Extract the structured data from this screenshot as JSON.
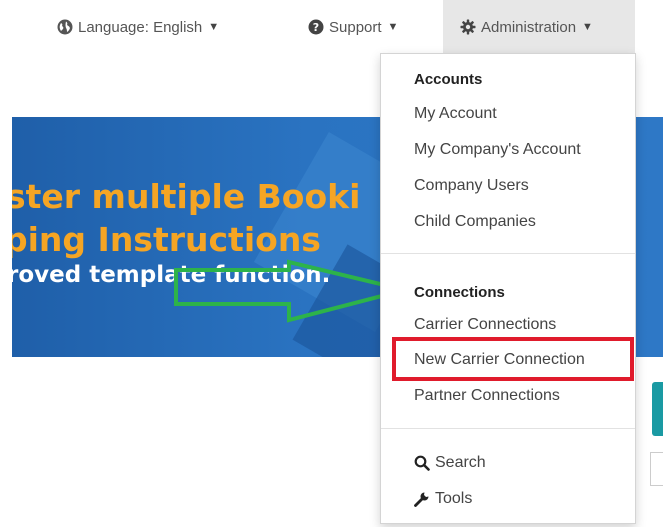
{
  "nav": {
    "language": {
      "label": "Language: English",
      "icon": "globe-icon",
      "caret": "▼"
    },
    "support": {
      "label": "Support",
      "icon": "question-circle-icon",
      "caret": "▼"
    },
    "administration": {
      "label": "Administration",
      "icon": "gear-icon",
      "caret": "▼"
    }
  },
  "banner": {
    "line1": "ster multiple Booki",
    "line2": "ping Instructions",
    "line3": "roved template function."
  },
  "menu": {
    "accounts_header": "Accounts",
    "accounts_items": [
      "My Account",
      "My Company's Account",
      "Company Users",
      "Child Companies"
    ],
    "connections_header": "Connections",
    "connections_items": [
      "Carrier Connections",
      "New Carrier Connection",
      "Partner Connections"
    ],
    "search_label": "Search",
    "tools_label": "Tools"
  },
  "colors": {
    "highlight": "#e01b2c",
    "arrow": "#2db34a",
    "banner_text": "#f5a524",
    "nav_active_bg": "#e7e7e7"
  }
}
